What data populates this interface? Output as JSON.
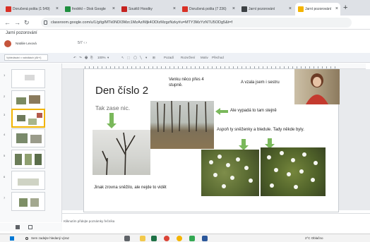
{
  "browser": {
    "tabs": [
      {
        "label": "Doručená pošta (1 549)",
        "icon": "gmail-icon",
        "color": "#d93025"
      },
      {
        "label": "fredrikl – Disk Google",
        "icon": "drive-icon",
        "color": "#1e8e3e"
      },
      {
        "label": "Soutěž Hoodky",
        "icon": "site-icon",
        "color": "#c5221f"
      },
      {
        "label": "Doručená pošta (7 236)",
        "icon": "gmail-icon",
        "color": "#d93025"
      },
      {
        "label": "Jarní pozorování",
        "icon": "classroom-icon",
        "color": "#3c4043"
      },
      {
        "label": "Jarní pozorování",
        "icon": "slides-icon",
        "color": "#f4b400"
      }
    ],
    "new_tab_label": "+",
    "url": "classroom.google.com/u/1/g/tg/MTk0NDI3Mzc1MzAz/Mjk4ODIzMzgzNzky#u=MTY3MzYzNTU5ODg5&t=f"
  },
  "app": {
    "title": "Jarní pozorování",
    "user_name": "Natálie Lexová",
    "user_controls": "5/7   ‹   ›"
  },
  "toolbar": {
    "theme_dropdown": "Vyhledávání v nabídkách (Alt+/)",
    "items": [
      "↶",
      "↷",
      "🖶",
      "⎘",
      "100%",
      "▾",
      "↖",
      "⬚",
      "◯",
      "╲",
      "▾",
      "⊞",
      "Pozadí",
      "Rozvržení",
      "Motiv",
      "Přechod"
    ]
  },
  "slide": {
    "title": "Den číslo 2",
    "text_tak_zase_nic": "Tak zase nic.",
    "text_venku": "Venku něco přes 4\nstupně.",
    "text_a_vzala": "A vzala jsem i sestru",
    "text_ale_vypada": "Ale vypadá to tam stejně",
    "text_aspon": "Aspoň ty sněženky a bledule. Tady někde byly.",
    "text_jinak": "Jinak zrovna sněžilo, ale nejde to vidět"
  },
  "filmstrip": {
    "slide_numbers": [
      "1",
      "2",
      "3",
      "4",
      "5",
      "6",
      "7"
    ]
  },
  "notes": {
    "placeholder": "Kliknutím přidejte poznámky řečníka"
  },
  "taskbar": {
    "search_placeholder": "Sem zadejte hledaný výraz",
    "weather": "2°C  Oblačno",
    "apps": [
      {
        "name": "task-view-icon",
        "color": "#5f6368"
      },
      {
        "name": "file-explorer-icon",
        "color": "#f2c94c"
      },
      {
        "name": "excel-icon",
        "color": "#1e7145"
      },
      {
        "name": "chrome-icon",
        "color": "#db4437"
      },
      {
        "name": "chrome-icon",
        "color": "#f4b400"
      },
      {
        "name": "store-icon",
        "color": "#34a853"
      },
      {
        "name": "word-icon",
        "color": "#2b579a"
      }
    ]
  },
  "colors": {
    "arrow_green": "#7ab85b",
    "selected_slide_border": "#f1b400"
  }
}
